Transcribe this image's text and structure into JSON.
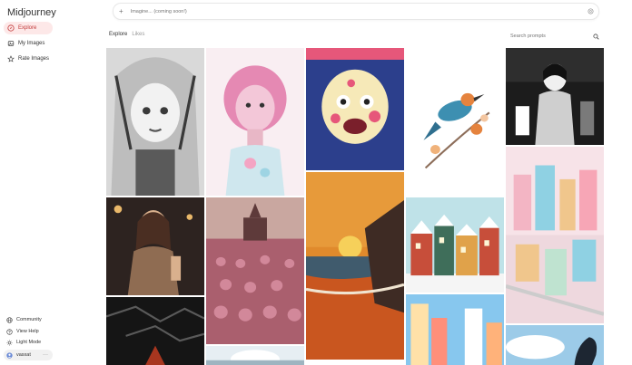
{
  "app": {
    "title": "Midjourney"
  },
  "sidebar": {
    "items": [
      {
        "label": "Explore",
        "icon": "compass-icon",
        "active": true
      },
      {
        "label": "My Images",
        "icon": "images-icon",
        "active": false
      },
      {
        "label": "Rate Images",
        "icon": "star-icon",
        "active": false
      }
    ],
    "bottom": [
      {
        "label": "Community",
        "icon": "globe-icon"
      },
      {
        "label": "View Help",
        "icon": "help-icon"
      },
      {
        "label": "Light Mode",
        "icon": "sun-icon"
      }
    ],
    "user": {
      "name": "vasxat",
      "more": "···"
    }
  },
  "prompt": {
    "plus": "+",
    "placeholder": "Imagine... (coming soon!)"
  },
  "tabs": [
    {
      "label": "Explore",
      "active": true
    },
    {
      "label": "Likes",
      "active": false
    }
  ],
  "search": {
    "placeholder": "Search prompts"
  },
  "gallery": [
    {
      "name": "sketch-girl-portrait",
      "colors": [
        "#d9d9d9",
        "#3a3a3a",
        "#f2f2f2"
      ]
    },
    {
      "name": "pink-hair-girl",
      "colors": [
        "#f3c7d8",
        "#e589b3",
        "#cfe7ee"
      ]
    },
    {
      "name": "cartoon-zombie-face",
      "colors": [
        "#2c3f8c",
        "#e6577a",
        "#f6e9b8"
      ]
    },
    {
      "name": "colorful-bird-branch",
      "colors": [
        "#ffffff",
        "#3d8fb1",
        "#e5833e"
      ]
    },
    {
      "name": "bw-woman-cafe",
      "colors": [
        "#1c1c1c",
        "#cfcfcf",
        "#ffffff"
      ]
    },
    {
      "name": "woman-portrait-bar",
      "colors": [
        "#2d2320",
        "#8f6c52",
        "#d9b08d"
      ]
    },
    {
      "name": "church-field",
      "colors": [
        "#c9a7a0",
        "#aa5f6e",
        "#5e3a3a"
      ]
    },
    {
      "name": "sunset-beach",
      "colors": [
        "#e08a2c",
        "#c9561f",
        "#405b6d"
      ]
    },
    {
      "name": "snowy-houses",
      "colors": [
        "#bfe2e8",
        "#c74e3a",
        "#3f6e5a"
      ]
    },
    {
      "name": "pastel-city",
      "colors": [
        "#f7e3e8",
        "#8fd1e3",
        "#f0c68c"
      ]
    },
    {
      "name": "cracked-dark",
      "colors": [
        "#151515",
        "#5a5a5a",
        "#a8361f"
      ]
    },
    {
      "name": "snowy-tree",
      "colors": [
        "#e6eef3",
        "#ffffff",
        "#9eb4c0"
      ]
    },
    {
      "name": "colorful-towers",
      "colors": [
        "#ffe1a8",
        "#ff8f7a",
        "#87c7ee"
      ]
    },
    {
      "name": "horse-sky",
      "colors": [
        "#9ccbe8",
        "#ffffff",
        "#1d2632"
      ]
    }
  ]
}
